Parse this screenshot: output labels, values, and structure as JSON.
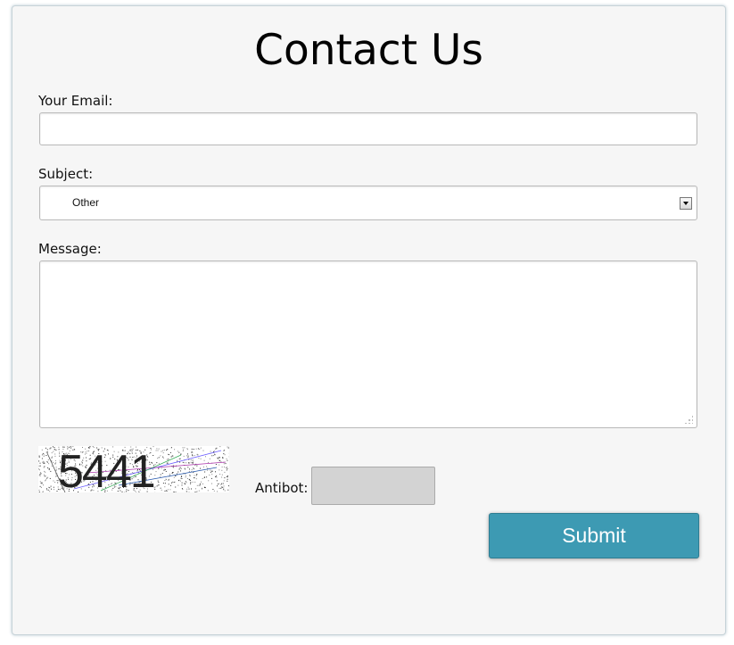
{
  "form": {
    "title": "Contact Us",
    "email_label": "Your Email:",
    "email_value": "",
    "subject_label": "Subject:",
    "subject_value": "Other",
    "message_label": "Message:",
    "message_value": "",
    "captcha_text": "5441",
    "antibot_label": "Antibot:",
    "antibot_value": "",
    "submit_label": "Submit"
  },
  "colors": {
    "panel_background": "#f6f6f6",
    "submit_button": "#3d9ab3",
    "antibot_field": "#d3d3d3"
  },
  "icons": [
    "dropdown-arrow-icon",
    "resize-handle-icon"
  ]
}
